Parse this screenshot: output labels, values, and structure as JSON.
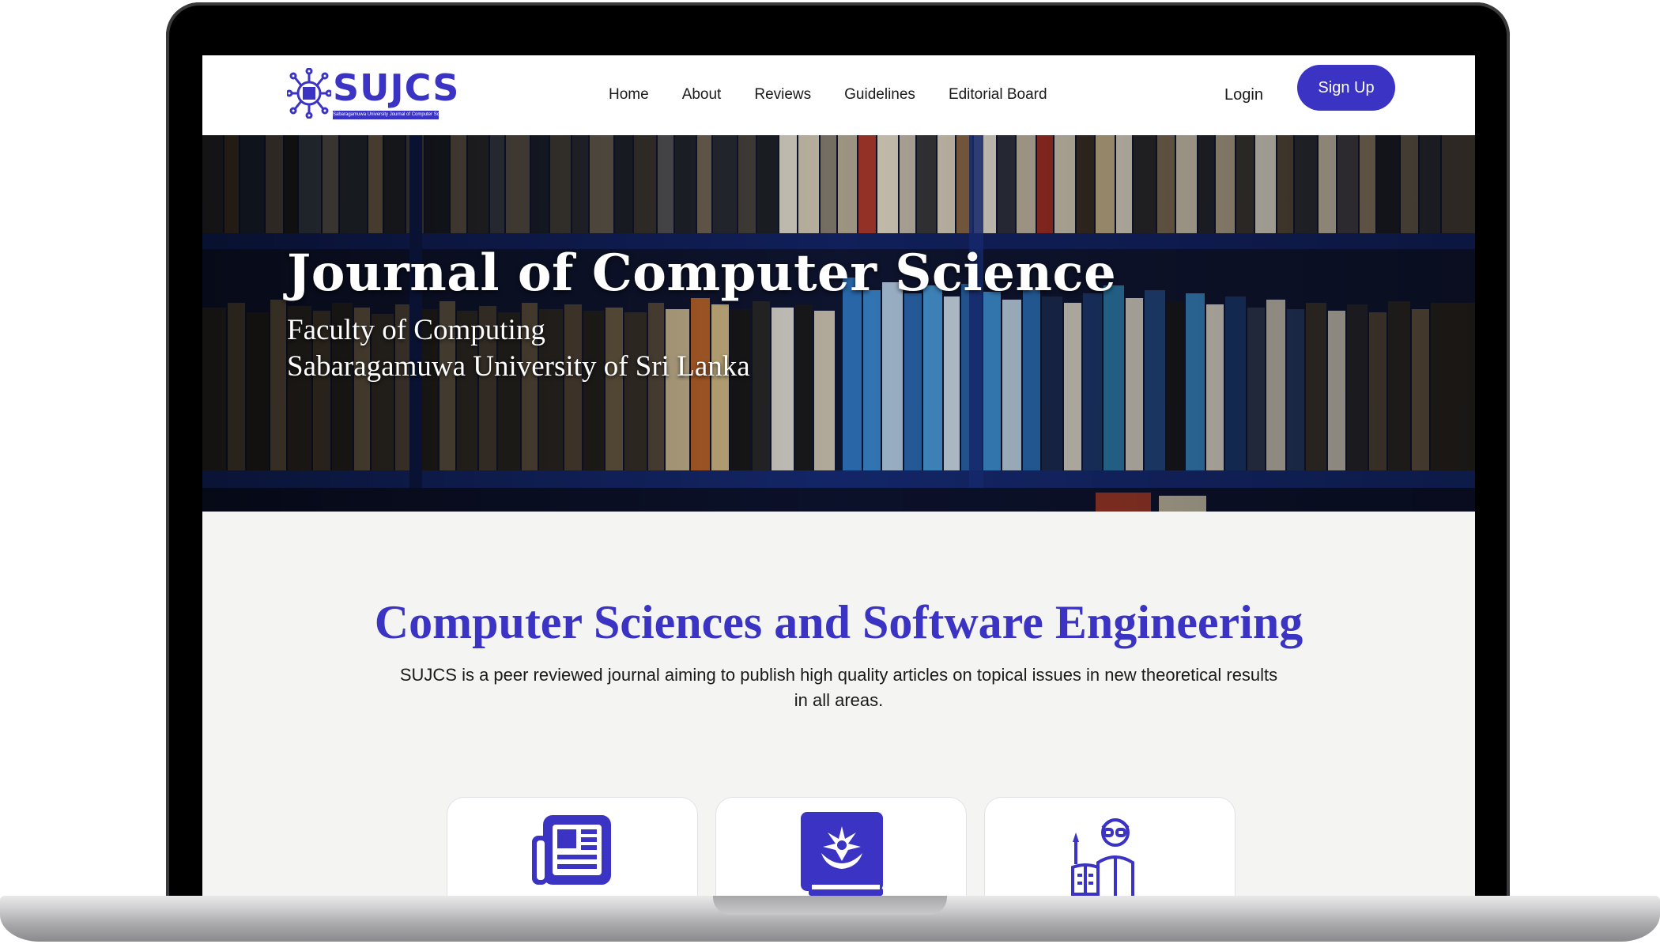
{
  "logo": {
    "text": "SUJCS",
    "tagline": "Sabaragamuwa University Journal of Computer Science"
  },
  "nav": {
    "items": [
      {
        "label": "Home"
      },
      {
        "label": "About"
      },
      {
        "label": "Reviews"
      },
      {
        "label": "Guidelines"
      },
      {
        "label": "Editorial Board"
      }
    ],
    "login_label": "Login",
    "signup_label": "Sign Up"
  },
  "hero": {
    "title": "Journal of Computer Science",
    "subtitle_line1": "Faculty of Computing",
    "subtitle_line2": "Sabaragamuwa University of Sri Lanka"
  },
  "section": {
    "title": "Computer Sciences and Software Engineering",
    "description": "SUJCS is a peer reviewed journal aiming to publish high quality articles on topical issues in new theoretical results in all areas."
  },
  "cards": [
    {
      "icon": "newspaper-icon"
    },
    {
      "icon": "book-emblem-icon"
    },
    {
      "icon": "scholar-reading-icon"
    }
  ],
  "colors": {
    "accent": "#3a33c4",
    "content_bg": "#f4f4f2"
  }
}
